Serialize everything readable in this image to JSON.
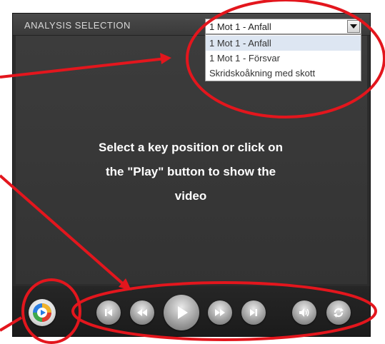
{
  "header": {
    "title": "ANALYSIS SELECTION"
  },
  "dropdown": {
    "selected": "1 Mot 1 - Anfall",
    "options": [
      "1 Mot 1 - Anfall",
      "1 Mot 1 - Försvar",
      "Skridskoåkning med skott"
    ]
  },
  "message": {
    "line1": "Select a key position or click on",
    "line2": "the \"Play\" button to show the",
    "line3": "video"
  },
  "controls": {
    "logo_icon": "media-player-logo-icon",
    "buttons": [
      "skip-previous-icon",
      "rewind-icon",
      "play-icon",
      "fast-forward-icon",
      "skip-next-icon",
      "volume-icon",
      "repeat-icon"
    ]
  },
  "annotation_color": "#e3161d"
}
